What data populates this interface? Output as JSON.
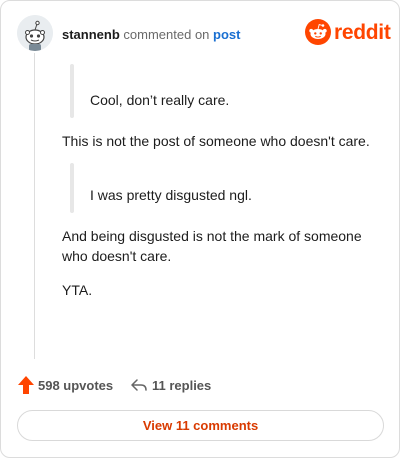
{
  "header": {
    "username": "stannenb",
    "verb": "commented on",
    "post_link": "post",
    "avatar_icon": "snoo-avatar-icon",
    "logo_icon": "reddit-alien-icon",
    "logo_text": "reddit"
  },
  "comment": {
    "quote_1": "Cool, don’t really care.",
    "para_1": "This is not the post of someone who doesn't care.",
    "quote_2": "I was pretty disgusted ngl.",
    "para_2": "And being disgusted is not the mark of someone who doesn't care.",
    "para_3": "YTA."
  },
  "footer": {
    "upvote_icon": "upvote-arrow-icon",
    "upvotes": "598 upvotes",
    "reply_icon": "reply-arrow-icon",
    "replies": "11 replies"
  },
  "view_button": "View 11 comments",
  "colors": {
    "brand": "#ff4500",
    "link": "#1a6fd1",
    "button_text": "#d93a00"
  }
}
